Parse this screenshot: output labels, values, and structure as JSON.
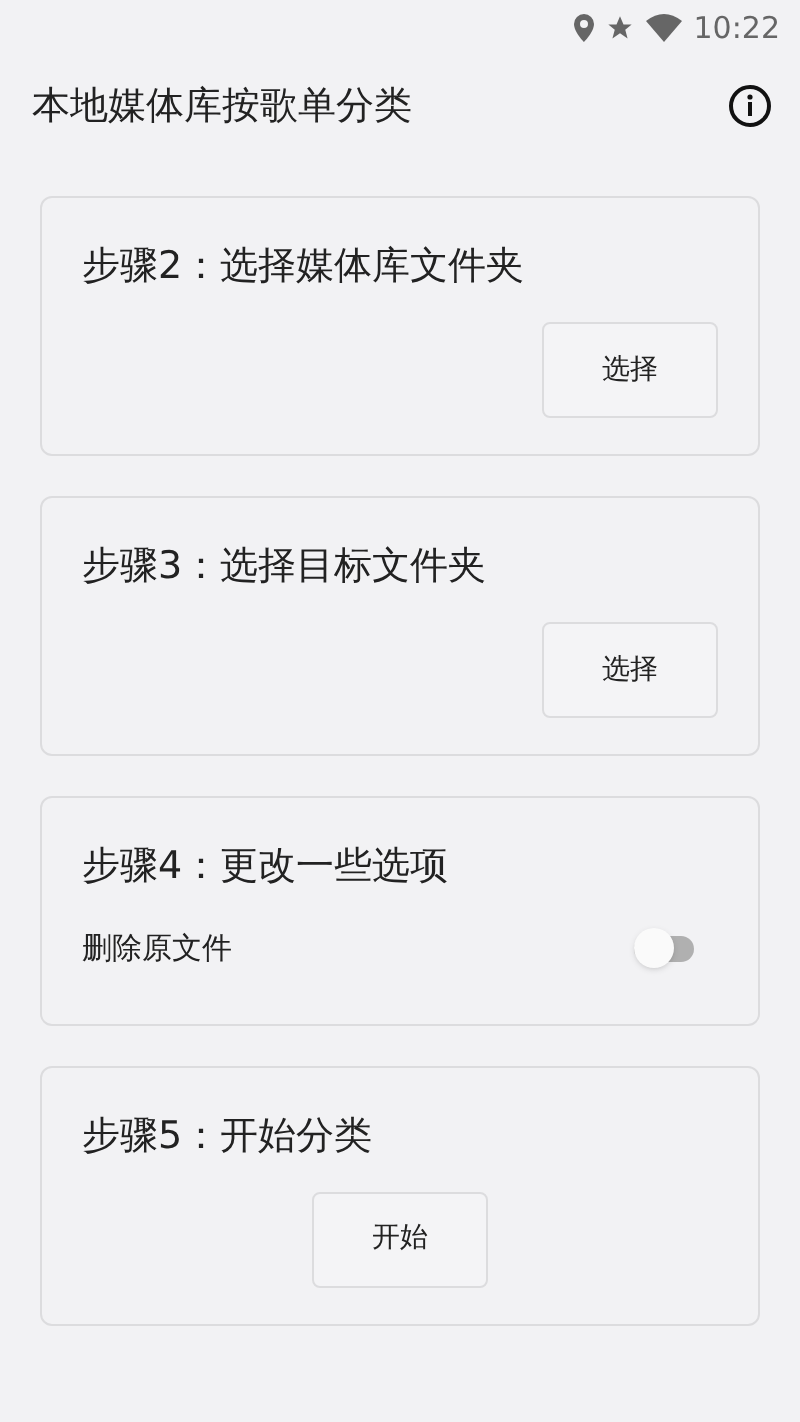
{
  "status_bar": {
    "time": "10:22"
  },
  "app_bar": {
    "title": "本地媒体库按歌单分类"
  },
  "cards": [
    {
      "kind": "select",
      "title": "步骤2：选择媒体库文件夹",
      "button": "选择"
    },
    {
      "kind": "select",
      "title": "步骤3：选择目标文件夹",
      "button": "选择"
    },
    {
      "kind": "switch",
      "title": "步骤4：更改一些选项",
      "label": "删除原文件",
      "on": false
    },
    {
      "kind": "start",
      "title": "步骤5：开始分类",
      "button": "开始"
    }
  ]
}
